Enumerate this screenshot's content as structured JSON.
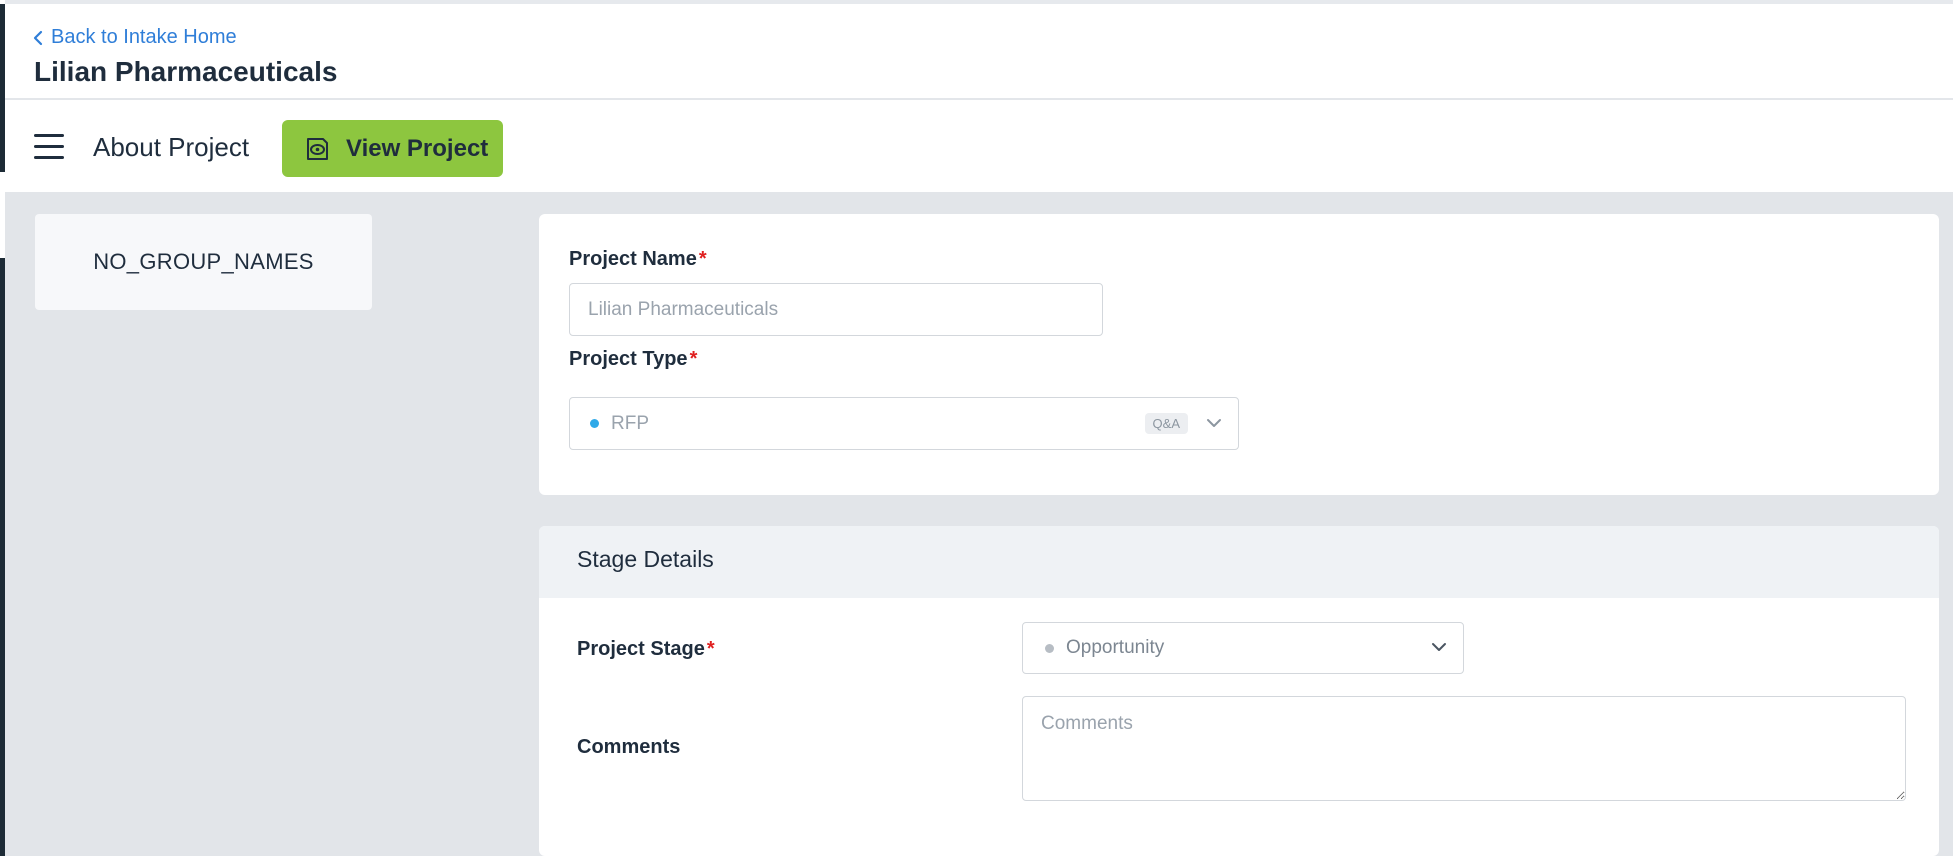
{
  "header": {
    "back_link": "Back to Intake Home",
    "title": "Lilian Pharmaceuticals"
  },
  "toolbar": {
    "section_label": "About Project",
    "view_button": "View Project",
    "accent_color": "#8dc63f"
  },
  "sidebar": {
    "group_name": "NO_GROUP_NAMES"
  },
  "project_form": {
    "name_label": "Project Name",
    "name_placeholder": "Lilian Pharmaceuticals",
    "type_label": "Project Type",
    "type_value": "RFP",
    "type_badge": "Q&A",
    "required_marker": "*"
  },
  "stage_details": {
    "title": "Stage Details",
    "stage_label": "Project Stage",
    "stage_value": "Opportunity",
    "comments_label": "Comments",
    "comments_placeholder": "Comments"
  },
  "icons": {
    "back": "chevron-left-icon",
    "menu": "hamburger-menu-icon",
    "view": "view-eye-icon",
    "dropdown": "chevron-down-icon"
  }
}
